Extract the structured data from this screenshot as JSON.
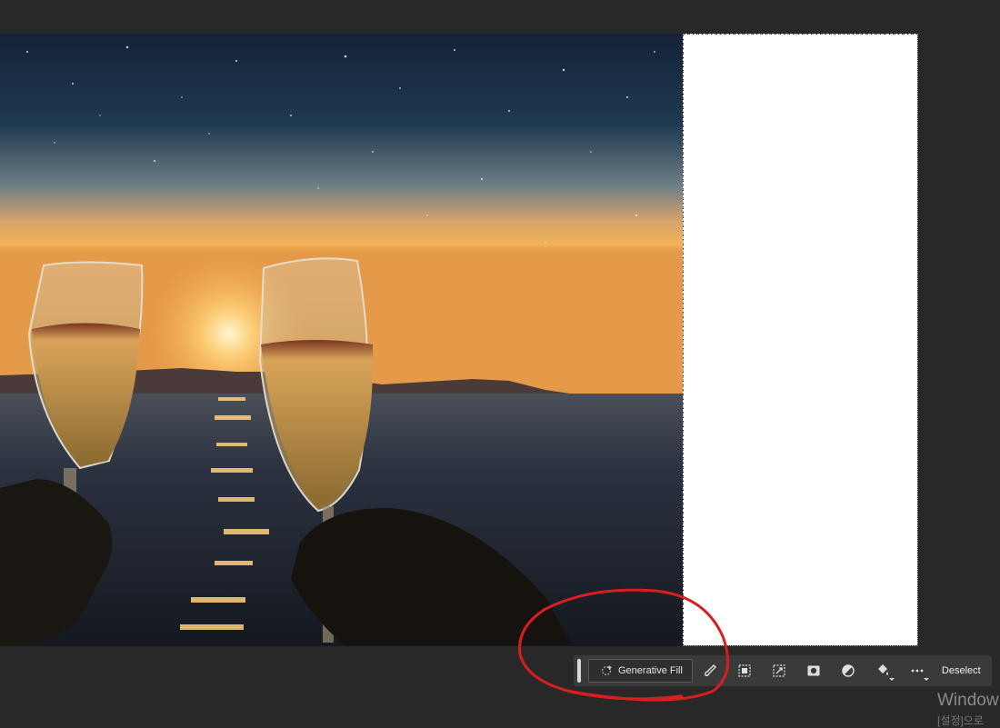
{
  "contextual_taskbar": {
    "generative_fill_label": "Generative Fill",
    "deselect_label": "Deselect",
    "tools": [
      {
        "name": "modify-selection-brush-icon"
      },
      {
        "name": "select-subject-icon"
      },
      {
        "name": "transform-selection-icon"
      },
      {
        "name": "create-mask-icon"
      },
      {
        "name": "adjustment-layer-icon"
      },
      {
        "name": "fill-selection-icon"
      },
      {
        "name": "more-options-icon"
      }
    ]
  },
  "watermark": {
    "title": "Window",
    "subtitle": "[설정]으로"
  },
  "colors": {
    "workspace_bg": "#282828",
    "taskbar_bg": "#3a3a3a",
    "annotation_red": "#d81e1e",
    "canvas_blank": "#ffffff"
  }
}
